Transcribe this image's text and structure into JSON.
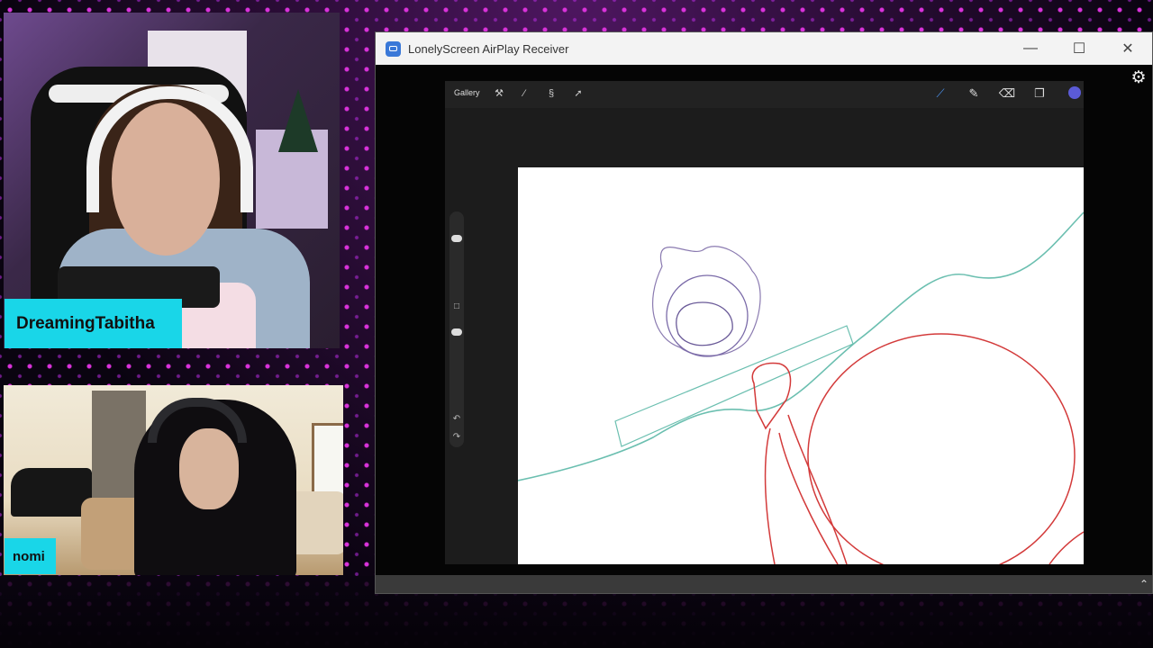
{
  "streamers": {
    "cam1_name": "DreamingTabitha",
    "cam2_name": "nomi"
  },
  "window": {
    "title": "LonelyScreen AirPlay Receiver",
    "minimize_glyph": "—",
    "maximize_glyph": "☐",
    "close_glyph": "✕",
    "icon": "lonelyscreen-app-icon",
    "settings_glyph": "⚙",
    "collapse_glyph": "⌃"
  },
  "procreate": {
    "gallery_label": "Gallery",
    "tools_left": [
      {
        "name": "wrench-icon",
        "glyph": "🔧"
      },
      {
        "name": "adjustments-icon",
        "glyph": "⁄"
      },
      {
        "name": "selection-icon",
        "glyph": "S"
      },
      {
        "name": "transform-icon",
        "glyph": "➚"
      }
    ],
    "tools_right": [
      {
        "name": "brush-icon",
        "glyph": "⟋"
      },
      {
        "name": "smudge-icon",
        "glyph": "✋"
      },
      {
        "name": "eraser-icon",
        "glyph": "⌫"
      },
      {
        "name": "layers-icon",
        "glyph": "❐"
      }
    ],
    "active_color": "#5b5bd6",
    "side_bar": {
      "modify_glyph": "□",
      "undo_glyph": "↶",
      "redo_glyph": "↷"
    }
  },
  "colors": {
    "name_tag": "#19d6e8",
    "sketch_teal": "#6bbfb0",
    "sketch_red": "#d33a3a",
    "sketch_purple": "#7a6aa8"
  }
}
